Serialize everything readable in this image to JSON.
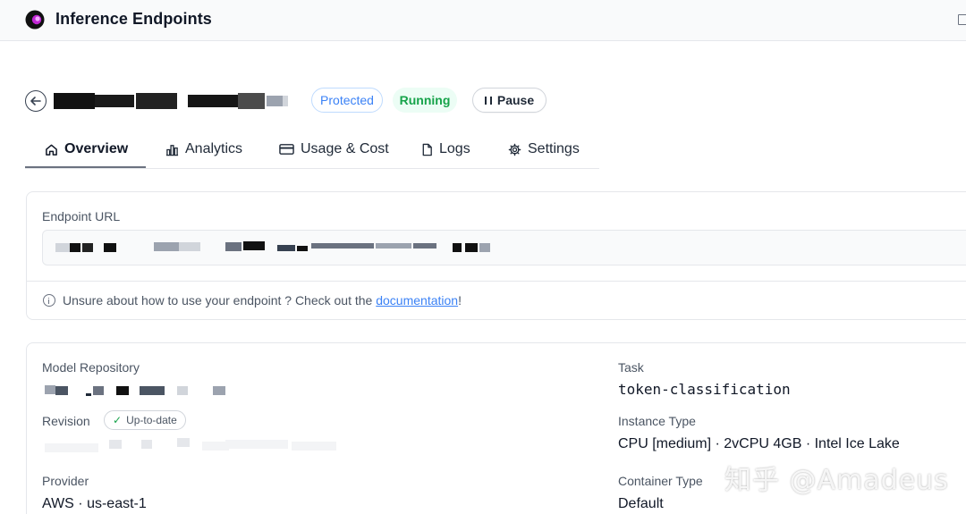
{
  "app": {
    "title": "Inference Endpoints"
  },
  "header": {
    "protected_label": "Protected",
    "status_label": "Running",
    "pause_label": "Pause"
  },
  "tabs": [
    {
      "label": "Overview",
      "icon": "home-icon",
      "active": true
    },
    {
      "label": "Analytics",
      "icon": "bar-chart-icon",
      "active": false
    },
    {
      "label": "Usage & Cost",
      "icon": "credit-card-icon",
      "active": false
    },
    {
      "label": "Logs",
      "icon": "file-icon",
      "active": false
    },
    {
      "label": "Settings",
      "icon": "gear-icon",
      "active": false
    }
  ],
  "endpoint": {
    "url_label": "Endpoint URL",
    "info_prefix": "Unsure about how to use your endpoint ? Check out the ",
    "info_link": "documentation",
    "info_suffix": "!"
  },
  "details": {
    "model_repository_label": "Model Repository",
    "revision_label": "Revision",
    "revision_badge": "Up-to-date",
    "provider_label": "Provider",
    "provider_value": "AWS · us-east-1",
    "task_label": "Task",
    "task_value": "token-classification",
    "instance_type_label": "Instance Type",
    "instance_type_value": "CPU [medium] · 2vCPU 4GB · Intel Ice Lake",
    "container_type_label": "Container Type",
    "container_type_value": "Default"
  },
  "watermark": "知乎 @Amadeus",
  "colors": {
    "accent_blue": "#3b82f6",
    "running_green": "#16a34a",
    "border": "#e5e7eb"
  }
}
